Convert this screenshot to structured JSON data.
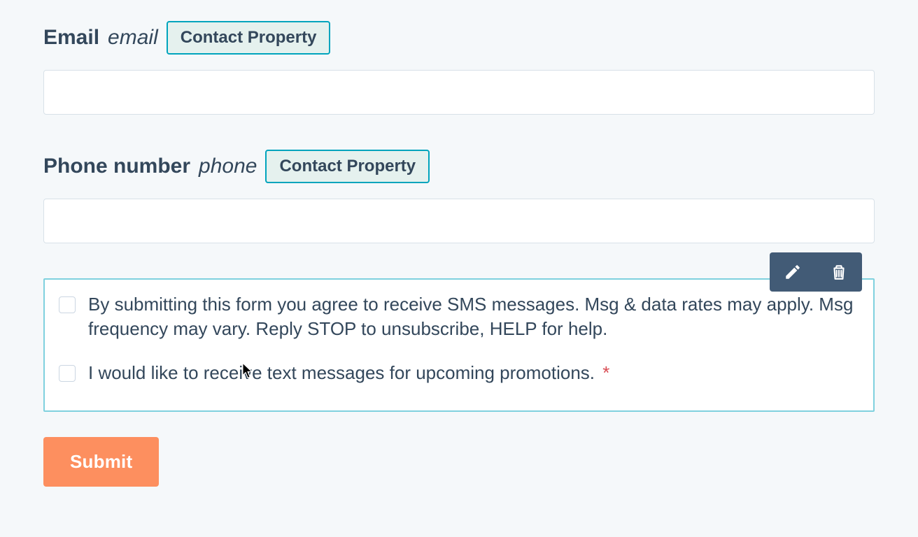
{
  "fields": {
    "email": {
      "label": "Email",
      "slug": "email",
      "tag": "Contact Property",
      "value": ""
    },
    "phone": {
      "label": "Phone number",
      "slug": "phone",
      "tag": "Contact Property",
      "value": ""
    }
  },
  "checkboxes": {
    "consent": {
      "label": "By submitting this form you agree to receive SMS messages. Msg & data rates may apply. Msg frequency may vary. Reply STOP to unsubscribe, HELP for help.",
      "checked": false,
      "required": false
    },
    "promotions": {
      "label": "I would like to receive text messages for upcoming promotions.",
      "checked": false,
      "required": true
    }
  },
  "required_mark": "*",
  "submit_label": "Submit",
  "icons": {
    "edit": "pencil-icon",
    "delete": "trash-icon"
  }
}
